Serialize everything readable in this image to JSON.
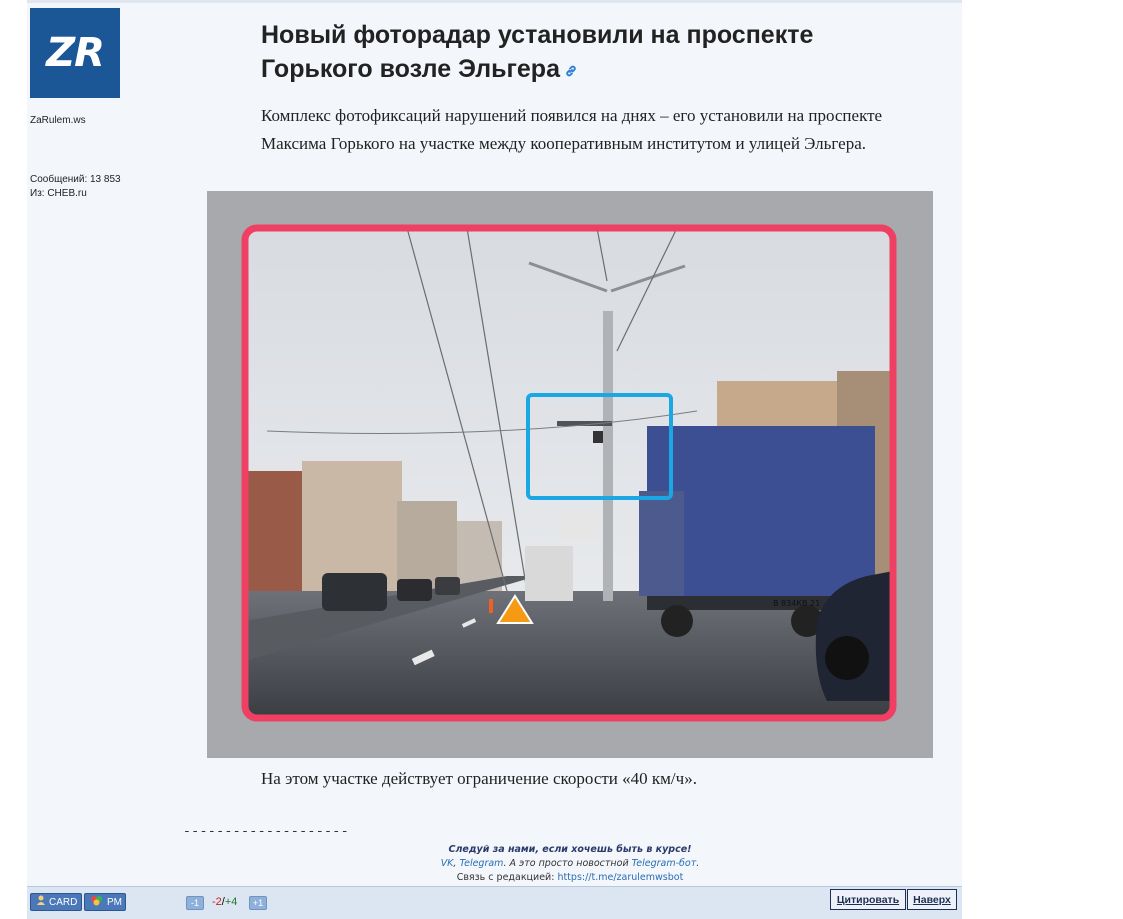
{
  "user": {
    "avatar_text": "ZR",
    "name": "ZaRulem.ws",
    "posts_line": "Сообщений: 13 853",
    "from_line": "Из: CHEB.ru"
  },
  "article": {
    "title": "Новый фоторадар установили на проспекте Горького возле Эльгера",
    "lead": "Комплекс фотофиксаций нарушений появился на днях – его установили на проспекте Максима Горького на участке между кооперативным институтом и улицей Эльгера.",
    "caption": "На этом участке действует ограничение скорости «40 км/ч».",
    "image_alt": "Фоторадар на проспекте Горького",
    "truck_plate": "В 834КВ 21"
  },
  "footer": {
    "separator": "--------------------",
    "promo_line1": "Следуй за нами, если хочешь быть в курсе!",
    "vk": "VK",
    "comma": ", ",
    "telegram": "Telegram",
    "promo_mid": ". А это просто новостной ",
    "telegram_bot": "Telegram-бот",
    "promo_end": ".",
    "contact_prefix": "Связь с редакцией: ",
    "contact_link": "https://t.me/zarulemwsbot"
  },
  "bar": {
    "card_label": "CARD",
    "pm_label": "PM",
    "minus_label": "-1",
    "rating_neg": "-2",
    "rating_sep": "/",
    "rating_pos": "+4",
    "plus_label": "+1",
    "quote_label": "Цитировать",
    "top_label": "Наверх"
  },
  "colors": {
    "avatar_bg": "#1b5797",
    "frame_red": "#ef3f63",
    "highlight_blue": "#1aa7e3",
    "rating_negative": "#c81e1e",
    "rating_positive": "#1f7a2b"
  },
  "icons": [
    "link-icon",
    "user-card-icon",
    "private-message-icon"
  ]
}
